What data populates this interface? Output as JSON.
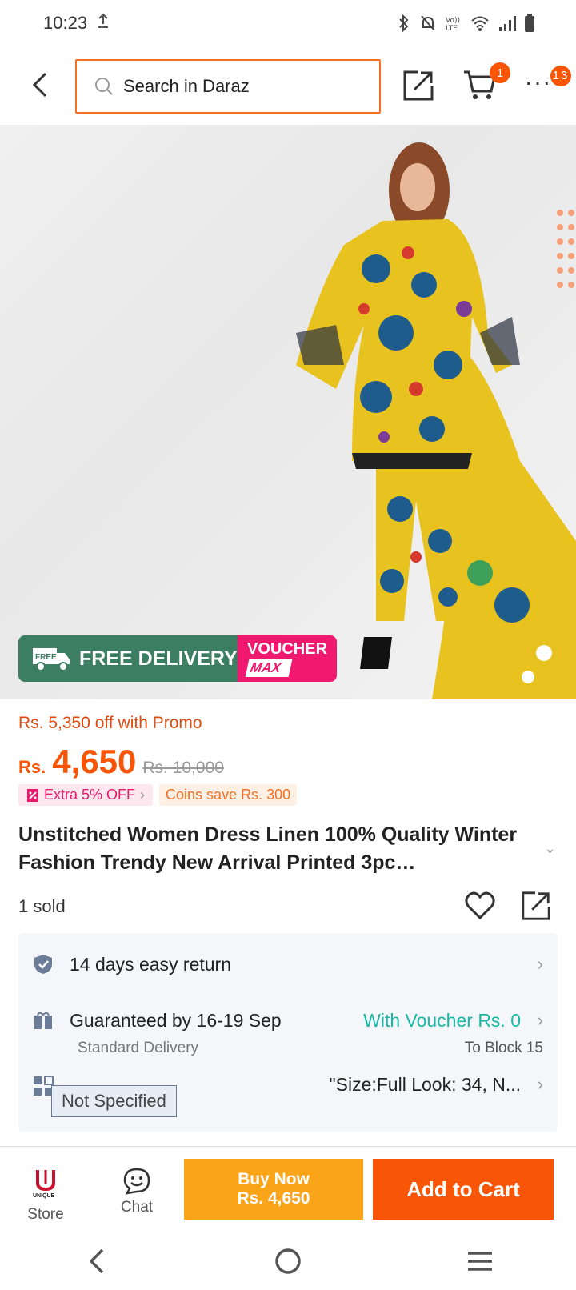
{
  "status_bar": {
    "time": "10:23"
  },
  "search": {
    "placeholder": "Search in Daraz"
  },
  "header": {
    "cart_count": "1",
    "more_count": "13"
  },
  "promo_banner": {
    "free_delivery": "FREE DELIVERY",
    "free_badge": "FREE",
    "voucher_line1": "VOUCHER",
    "voucher_line2": "MAX"
  },
  "pricing": {
    "promo_text": "Rs. 5,350 off with Promo",
    "currency": "Rs.",
    "price": "4,650",
    "old_price": "Rs. 10,000",
    "extra_off": "Extra 5% OFF",
    "coins_save": "Coins save Rs. 300"
  },
  "product": {
    "title": "Unstitched Women Dress Linen 100% Quality Winter Fashion Trendy New Arrival Printed 3pc…",
    "sold": "1 sold"
  },
  "info": {
    "return": "14 days easy return",
    "delivery_guarantee": "Guaranteed by 16-19 Sep",
    "delivery_type": "Standard Delivery",
    "voucher": "With Voucher Rs. 0",
    "destination": "To Block 15",
    "spec_tag": "Not Specified",
    "size": "\"Size:Full Look: 34, N..."
  },
  "bottom_bar": {
    "store_label": "Store",
    "store_logo_text": "UNIQUE",
    "chat_label": "Chat",
    "buy_now_line1": "Buy Now",
    "buy_now_line2": "Rs. 4,650",
    "add_to_cart": "Add to Cart"
  },
  "colors": {
    "accent": "#f85606",
    "buy_now": "#faa41a",
    "voucher_green": "#1bb7a6",
    "delivery_green": "#3b7e61",
    "voucher_pink": "#f0186f"
  }
}
